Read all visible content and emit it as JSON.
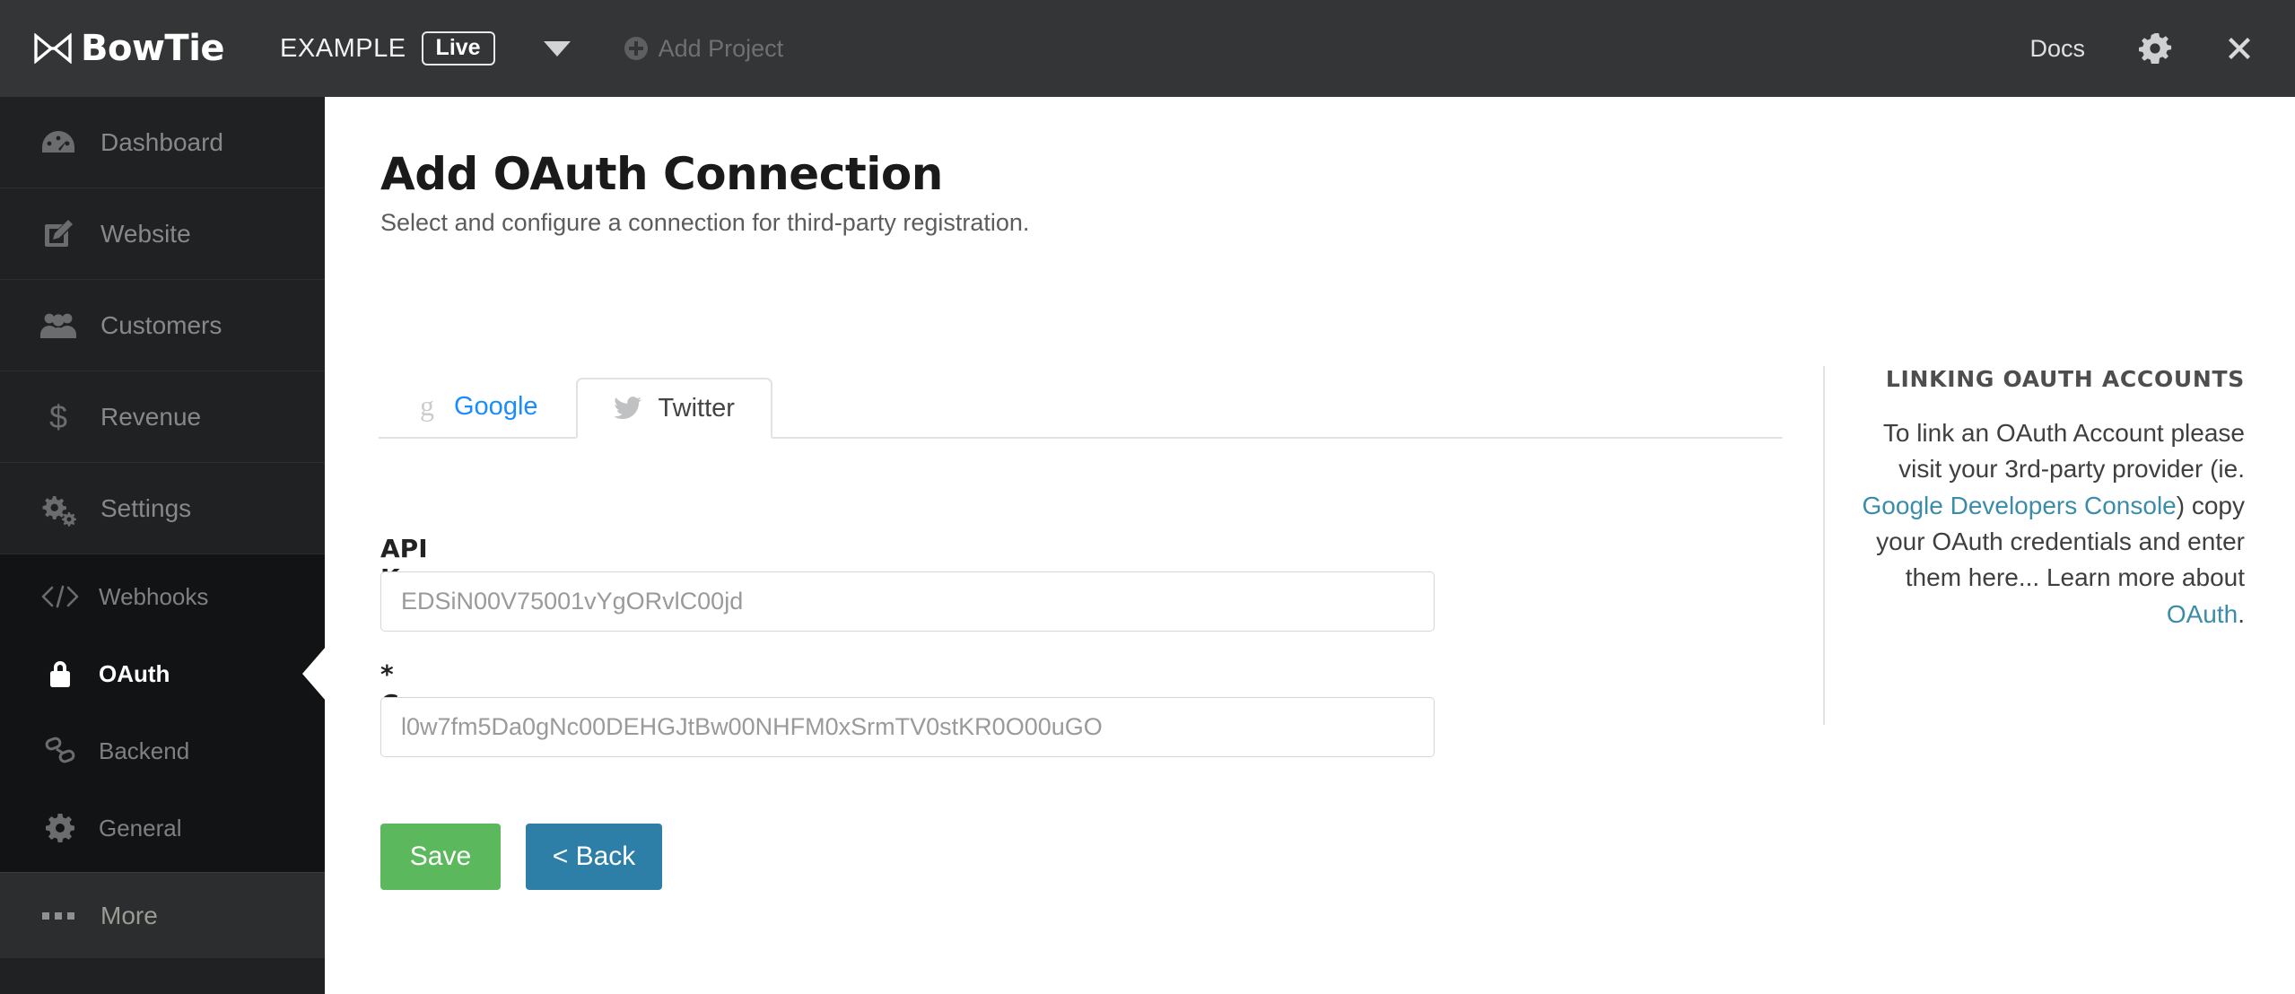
{
  "header": {
    "brand_name": "BowTie",
    "brand_icon": "bowtie-logo-icon",
    "project_name": "EXAMPLE",
    "status_badge": "Live",
    "project_dropdown_icon": "chevron-down-icon",
    "add_project_label": "Add Project",
    "add_project_icon": "plus-circle-icon",
    "docs_label": "Docs",
    "settings_icon": "gear-icon",
    "close_icon": "close-icon",
    "background_color": "#333536"
  },
  "sidebar": {
    "background_color": "#1f2122",
    "items": [
      {
        "label": "Dashboard",
        "icon": "dashboard-gauge-icon"
      },
      {
        "label": "Website",
        "icon": "pencil-square-icon"
      },
      {
        "label": "Customers",
        "icon": "users-icon"
      },
      {
        "label": "Revenue",
        "icon": "dollar-sign-icon"
      },
      {
        "label": "Settings",
        "icon": "gears-icon"
      }
    ],
    "subitems": [
      {
        "label": "Webhooks",
        "icon": "code-brackets-icon",
        "active": false
      },
      {
        "label": "OAuth",
        "icon": "lock-icon",
        "active": true
      },
      {
        "label": "Backend",
        "icon": "chain-link-icon",
        "active": false
      },
      {
        "label": "General",
        "icon": "gear-icon",
        "active": false
      }
    ],
    "more": {
      "label": "More",
      "icon": "ellipsis-icon"
    }
  },
  "main": {
    "title": "Add OAuth Connection",
    "subtitle": "Select and configure a connection for third-party registration.",
    "tabs": [
      {
        "label": "Google",
        "icon": "google-g-icon",
        "active": false
      },
      {
        "label": "Twitter",
        "icon": "twitter-bird-icon",
        "active": true
      }
    ],
    "form": {
      "api_key": {
        "label": "API Key",
        "value": "",
        "placeholder": "EDSiN00V75001vYgORvlC00jd"
      },
      "consumer_secret": {
        "label": "* Consumer Secret",
        "value": "",
        "placeholder": "l0w7fm5Da0gNc00DEHGJtBw00NHFM0xSrmTV0stKR0O00uGO"
      },
      "save_label": "Save",
      "back_label": "< Back",
      "save_color": "#5cb85c",
      "back_color": "#2e7fa8"
    }
  },
  "help": {
    "title": "LINKING OAUTH ACCOUNTS",
    "text_1": "To link an OAuth Account please visit your 3rd-party provider (ie. ",
    "link_1": "Google Developers Console",
    "text_2": ") copy your OAuth credentials and enter them here... Learn more about ",
    "link_2": "OAuth",
    "text_3": ".",
    "link_color": "#3b8ca8"
  }
}
